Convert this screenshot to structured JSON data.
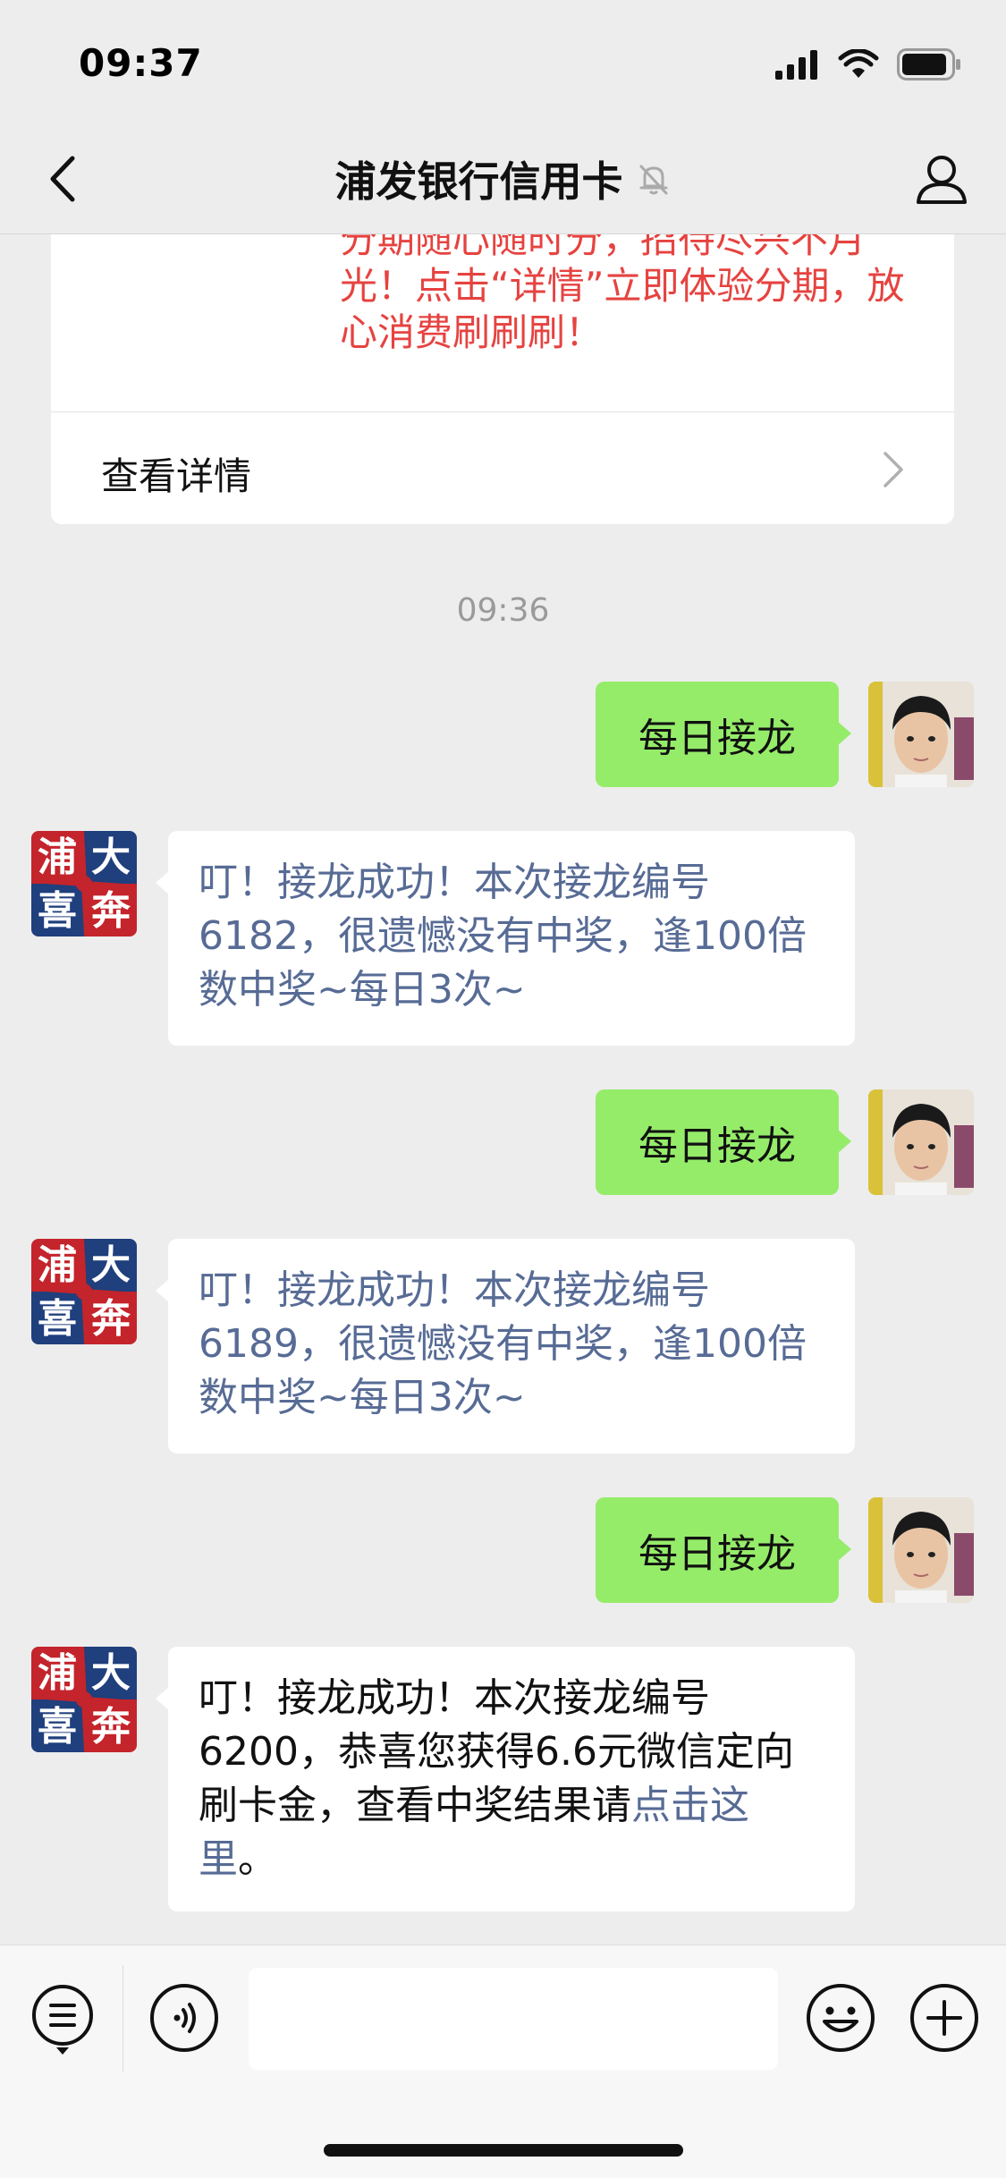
{
  "status_bar": {
    "time": "09:37"
  },
  "nav": {
    "title": "浦发银行信用卡",
    "muted": true
  },
  "article": {
    "text_partial": "分期随心随时分，招待尽兴不月光！点击“详情”立即体验分期，放心消费刷刷刷！",
    "link_label": "查看详情"
  },
  "timestamp": "09:36",
  "bank_avatar_text": [
    "浦",
    "大",
    "喜",
    "奔"
  ],
  "messages": [
    {
      "sender": "self",
      "text": "每日接龙"
    },
    {
      "sender": "bank",
      "text": "叮！接龙成功！本次接龙编号6182，很遗憾没有中奖，逢100倍数中奖~每日3次~"
    },
    {
      "sender": "self",
      "text": "每日接龙"
    },
    {
      "sender": "bank",
      "text": "叮！接龙成功！本次接龙编号6189，很遗憾没有中奖，逢100倍数中奖~每日3次~"
    },
    {
      "sender": "self",
      "text": "每日接龙"
    },
    {
      "sender": "bank",
      "text": "叮！接龙成功！本次接龙编号6200，恭喜您获得6.6元微信定向刷卡金，查看中奖结果请",
      "link": "点击这里",
      "suffix": "。"
    }
  ],
  "input": {
    "placeholder": ""
  },
  "colors": {
    "sent_bubble": "#95ec69",
    "link": "#576b95",
    "article_red": "#e64340",
    "background": "#ededed"
  },
  "icons": [
    "back-chevron",
    "mute-bell",
    "profile",
    "menu-list",
    "voice",
    "emoji",
    "plus"
  ]
}
